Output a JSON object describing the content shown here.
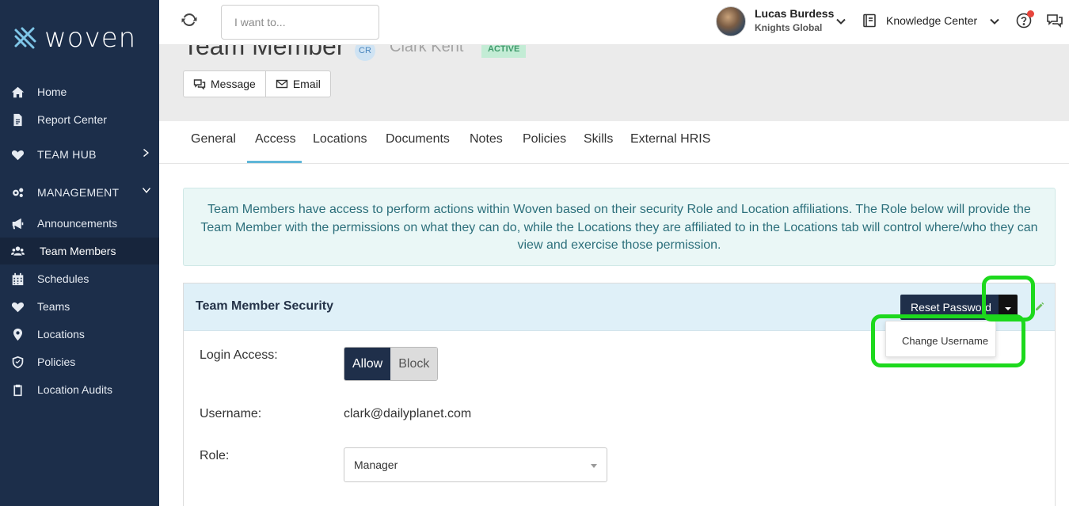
{
  "brand": {
    "name": "woven"
  },
  "sidebar": {
    "items": [
      {
        "label": "Home",
        "icon": "home-icon"
      },
      {
        "label": "Report Center",
        "icon": "report-icon"
      },
      {
        "label": "TEAM HUB",
        "icon": "heart-icon",
        "expander": "chevron-right-icon"
      },
      {
        "label": "MANAGEMENT",
        "icon": "gears-icon",
        "expander": "chevron-down-icon"
      },
      {
        "label": "Announcements",
        "icon": "bullhorn-icon"
      },
      {
        "label": "Team Members",
        "icon": "users-icon",
        "active": true
      },
      {
        "label": "Schedules",
        "icon": "calendar-icon"
      },
      {
        "label": "Teams",
        "icon": "heart-icon"
      },
      {
        "label": "Locations",
        "icon": "map-pin-icon"
      },
      {
        "label": "Policies",
        "icon": "shield-check-icon"
      },
      {
        "label": "Location Audits",
        "icon": "clipboard-icon"
      }
    ]
  },
  "topbar": {
    "search_placeholder": "I want to...",
    "user_name": "Lucas Burdess",
    "user_org": "Knights Global",
    "knowledge_center": "Knowledge Center"
  },
  "header": {
    "title": "Team Member",
    "initials": "CR",
    "person_name": "Clark Kent",
    "status": "ACTIVE",
    "message_label": "Message",
    "email_label": "Email"
  },
  "tabs": [
    "General",
    "Access",
    "Locations",
    "Documents",
    "Notes",
    "Policies",
    "Skills",
    "External HRIS"
  ],
  "active_tab": "Access",
  "info_text": "Team Members have access to perform actions within Woven based on their security Role and Location affiliations. The Role below will provide the Team Member with the permissions on what they can do, while the Locations they are affiliated to in the Locations tab will control where/who they can view and exercise those permission.",
  "security": {
    "title": "Team Member Security",
    "reset_label": "Reset Password",
    "menu_items": [
      "Change Username"
    ],
    "login_access_label": "Login Access:",
    "allow_label": "Allow",
    "block_label": "Block",
    "login_access_value": "Allow",
    "username_label": "Username:",
    "username_value": "clark@dailyplanet.com",
    "role_label": "Role:",
    "role_value": "Manager"
  },
  "colors": {
    "sidebar_bg": "#1c2e4a",
    "primary_button": "#1f2f4a",
    "tab_accent": "#5fb6d8",
    "info_bg": "#eaf7f6",
    "card_head_bg": "#dff0f8",
    "highlight": "#1dd91d"
  }
}
